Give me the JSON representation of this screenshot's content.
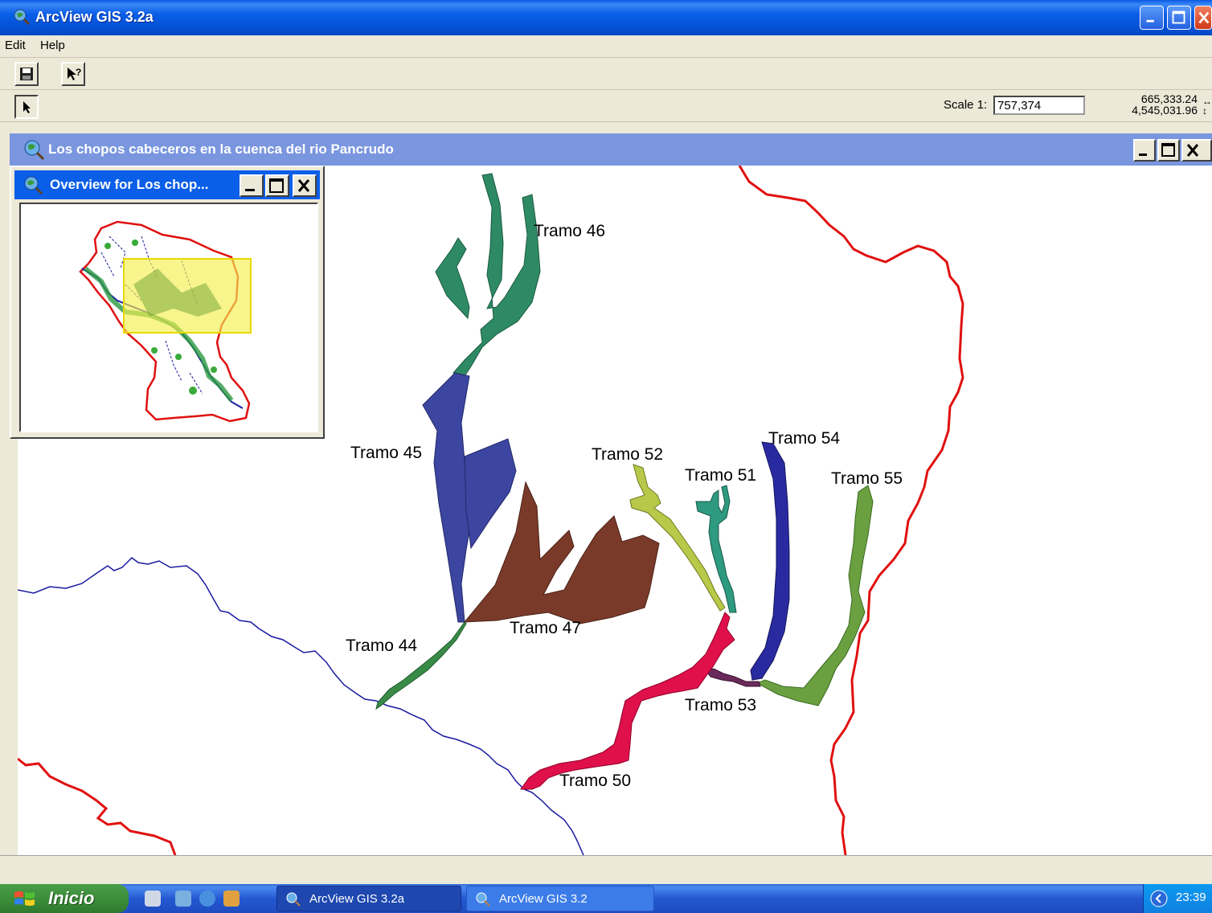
{
  "app": {
    "title": "ArcView GIS 3.2a"
  },
  "menu": {
    "items": [
      "Edit",
      "Help"
    ]
  },
  "toolbar": {
    "scale_label": "Scale 1:",
    "scale_value": "757,374",
    "coord_x": "665,333.24",
    "coord_y": "4,545,031.96"
  },
  "view": {
    "title": "Los chopos cabeceros en la cuenca del rio Pancrudo"
  },
  "overview": {
    "title": "Overview for Los chop..."
  },
  "map": {
    "labels": [
      "Tramo 46",
      "Tramo 45",
      "Tramo 52",
      "Tramo 51",
      "Tramo 54",
      "Tramo 55",
      "Tramo 47",
      "Tramo 44",
      "Tramo 53",
      "Tramo 50"
    ],
    "colors": {
      "tramo_46": "#2e8a64",
      "tramo_45": "#3c46a0",
      "tramo_47": "#7a3a2a",
      "tramo_44": "#3a8a48",
      "tramo_52": "#b8c848",
      "tramo_51": "#2e9a80",
      "tramo_54": "#2a2aa0",
      "tramo_55": "#6aa040",
      "tramo_53": "#6a2a5a",
      "tramo_50": "#e0104a",
      "boundary": "#e01010",
      "river": "#1a1aa0"
    }
  },
  "taskbar": {
    "start_label": "Inicio",
    "tasks": [
      "ArcView GIS 3.2a",
      "ArcView GIS 3.2"
    ],
    "time": "23:39"
  }
}
